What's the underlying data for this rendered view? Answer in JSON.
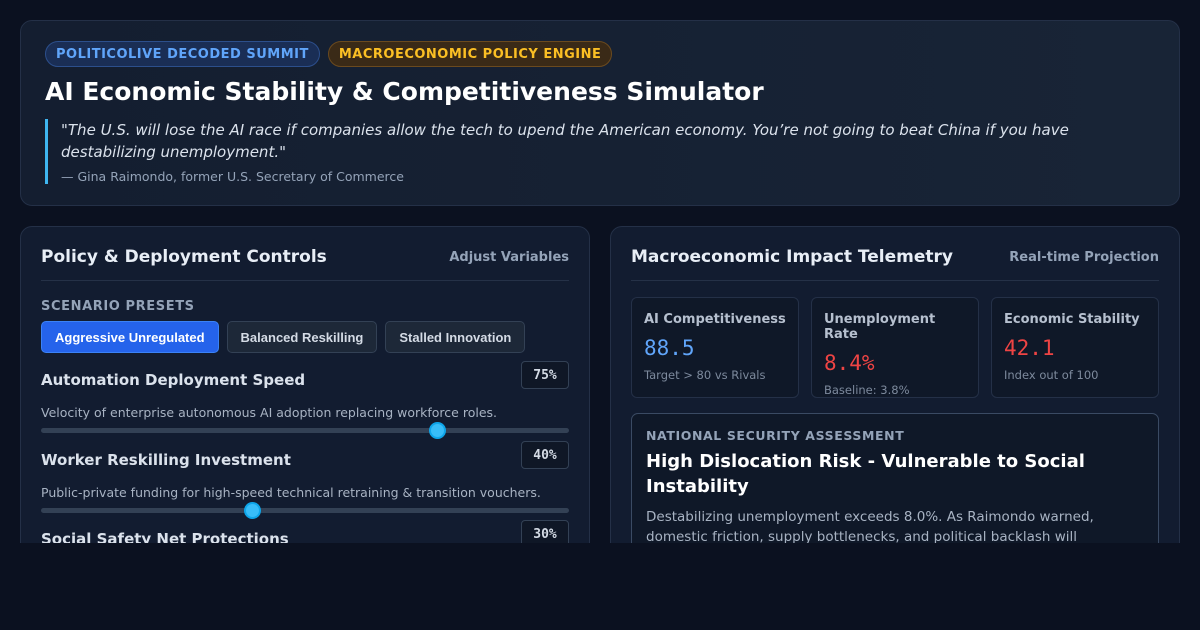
{
  "header": {
    "badges": [
      "POLITICOLIVE DECODED SUMMIT",
      "MACROECONOMIC POLICY ENGINE"
    ],
    "title": "AI Economic Stability & Competitiveness Simulator",
    "quote": "\"The U.S. will lose the AI race if companies allow the tech to upend the American economy. You’re not going to beat China if you have destabilizing unemployment.\"",
    "attribution": "— Gina Raimondo, former U.S. Secretary of Commerce"
  },
  "controls": {
    "title": "Policy & Deployment Controls",
    "aside": "Adjust Variables",
    "presets_label": "SCENARIO PRESETS",
    "presets": [
      "Aggressive Unregulated",
      "Balanced Reskilling",
      "Stalled Innovation"
    ],
    "active_preset": 0,
    "sliders": [
      {
        "label": "Automation Deployment Speed",
        "value_text": "75%",
        "level": 0.75,
        "description": "Velocity of enterprise autonomous AI adoption replacing workforce roles."
      },
      {
        "label": "Worker Reskilling Investment",
        "value_text": "40%",
        "level": 0.4,
        "description": "Public-private funding for high-speed technical retraining & transition vouchers."
      },
      {
        "label": "Social Safety Net Protections",
        "value_text": "30%",
        "level": 0.3,
        "description": ""
      }
    ]
  },
  "telemetry": {
    "title": "Macroeconomic Impact Telemetry",
    "aside": "Real-time Projection",
    "metrics": [
      {
        "label": "AI Competitiveness",
        "value": "88.5",
        "sub": "Target > 80 vs Rivals",
        "color": "#60a5fa"
      },
      {
        "label": "Unemployment Rate",
        "value": "8.4%",
        "sub": "Baseline: 3.8%",
        "color": "#ef4444"
      },
      {
        "label": "Economic Stability",
        "value": "42.1",
        "sub": "Index out of 100",
        "color": "#ef4444"
      }
    ],
    "assessment": {
      "label": "NATIONAL SECURITY ASSESSMENT",
      "headline": "High Dislocation Risk - Vulnerable to Social Instability",
      "body": "Destabilizing unemployment exceeds 8.0%. As Raimondo warned, domestic friction, supply bottlenecks, and political backlash will compromise long-term"
    }
  }
}
